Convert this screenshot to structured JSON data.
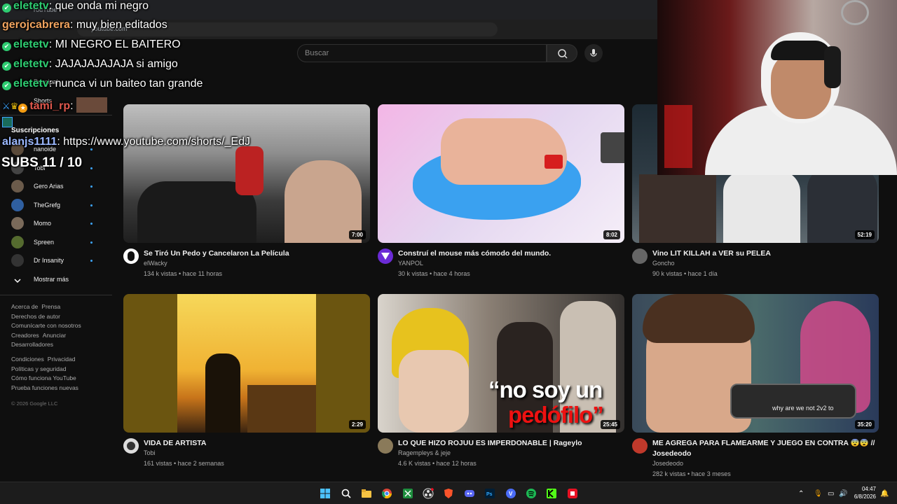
{
  "browser": {
    "tab_label": "YouTube",
    "url": "youtube.com"
  },
  "search": {
    "placeholder": "Buscar"
  },
  "sidebar": {
    "top_items": [
      "Principal",
      "Shorts"
    ],
    "subscriptions_title": "Suscripciones",
    "subscriptions": [
      "nanoide",
      "Tobi",
      "Gero Arias",
      "TheGrefg",
      "Momo",
      "Spreen",
      "Dr Insanity"
    ],
    "show_more": "Mostrar más",
    "footer1": [
      "Acerca de",
      "Prensa",
      "Derechos de autor",
      "Comunícarte con nosotros",
      "Creadores",
      "Anunciar",
      "Desarrolladores"
    ],
    "footer2": [
      "Condiciones",
      "Privacidad",
      "Políticas y seguridad",
      "Cómo funciona YouTube",
      "Prueba funciones nuevas"
    ],
    "copyright": "© 2026 Google LLC"
  },
  "videos": [
    {
      "title": "Se Tiró Un Pedo y Cancelaron La Película",
      "channel": "elWacky",
      "meta": "134 k vistas • hace 11 horas",
      "duration": "7:00"
    },
    {
      "title": "Construí el mouse más cómodo del mundo.",
      "channel": "YANPOL",
      "meta": "30 k vistas • hace 4 horas",
      "duration": "8:02"
    },
    {
      "title": "Vino LIT KILLAH a VER su PELEA",
      "channel": "Goncho",
      "meta": "90 k vistas • hace 1 día",
      "duration": "52:19"
    },
    {
      "title": "VIDA DE ARTISTA",
      "channel": "Tobi",
      "meta": "161 vistas • hace 2 semanas",
      "duration": "2:29"
    },
    {
      "title": "LO QUE HIZO ROJUU ES IMPERDONABLE | Rageylo",
      "channel": "Ragempleys & jeje",
      "meta": "4.6 K vistas • hace 12 horas",
      "duration": "25:45",
      "thumb_text_1": "“no soy un",
      "thumb_text_2": "pedófilo”"
    },
    {
      "title": "ME AGREGA PARA FLAMEARME Y JUEGO EN CONTRA 😨😨 // Josedeodo",
      "channel": "Josedeodo",
      "meta": "282 k vistas • hace 3 meses",
      "duration": "35:20",
      "thumb_text_1": "why are we not 2v2 to"
    }
  ],
  "chat": {
    "messages": [
      {
        "user": "eletetv",
        "text": ": que onda mi negro",
        "color": "#2ecc71"
      },
      {
        "user": "gerojcabrera",
        "text": ": muy bien editados",
        "color": "#f0a35e"
      },
      {
        "user": "eletetv",
        "text": ": MI NEGRO EL BAITERO",
        "color": "#2ecc71"
      },
      {
        "user": "eletetv",
        "text": ": JAJAJAJAJAJA si amigo",
        "color": "#2ecc71"
      },
      {
        "user": "eletetv",
        "text": ": nunca vi un baiteo tan grande",
        "color": "#2ecc71"
      },
      {
        "user": "tami_rp",
        "text": ":",
        "color": "#e0584d"
      },
      {
        "user": "alanjs1111",
        "text": ": https://www.youtube.com/shorts/_EdJ",
        "color": "#9bb8ff"
      }
    ],
    "subs": "SUBS 11 / 10"
  },
  "taskbar": {
    "time": "04:47",
    "date": "6/8/2026"
  },
  "colors": {
    "bg": "#0f0f0f",
    "accent_dot": "#3ea6ff",
    "chat_green": "#2ecc71",
    "taskbar": "#1c1c1c"
  }
}
